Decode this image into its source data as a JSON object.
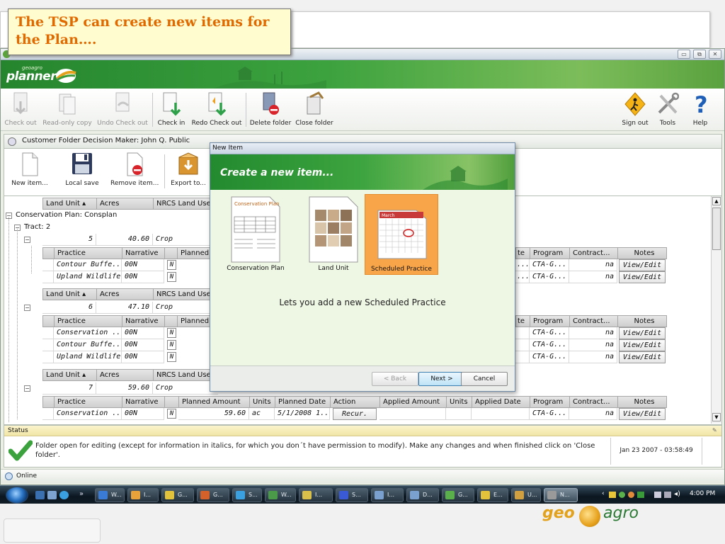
{
  "callout": {
    "text": "The TSP can create new items for the Plan…."
  },
  "window": {
    "title_controls": {
      "minimize": "▭",
      "restore": "⧉",
      "close": "✕"
    },
    "brand": {
      "small": "geoagro",
      "logo": "planner"
    }
  },
  "main_toolbar": {
    "left": [
      {
        "label": "Check out",
        "icon": "check-out-icon",
        "enabled": false
      },
      {
        "label": "Read-only copy",
        "icon": "read-only-copy-icon",
        "enabled": false
      },
      {
        "label": "Undo Check out",
        "icon": "undo-check-out-icon",
        "enabled": false
      },
      {
        "label": "Check in",
        "icon": "check-in-icon",
        "enabled": true
      },
      {
        "label": "Redo Check out",
        "icon": "redo-check-out-icon",
        "enabled": true
      },
      {
        "label": "Delete folder",
        "icon": "delete-folder-icon",
        "enabled": true
      },
      {
        "label": "Close folder",
        "icon": "close-folder-icon",
        "enabled": true
      }
    ],
    "right": [
      {
        "label": "Sign out",
        "icon": "sign-out-icon"
      },
      {
        "label": "Tools",
        "icon": "tools-icon"
      },
      {
        "label": "Help",
        "icon": "help-icon"
      }
    ]
  },
  "folder": {
    "header": "Customer Folder Decision Maker: John Q. Public",
    "toolbar": [
      {
        "label": "New item...",
        "icon": "new-item-icon"
      },
      {
        "label": "Local save",
        "icon": "floppy-disk-icon"
      },
      {
        "label": "Remove item...",
        "icon": "remove-item-icon"
      },
      {
        "label": "Export to...",
        "icon": "export-icon"
      }
    ]
  },
  "grid": {
    "land_headers": [
      "Land Unit",
      "Acres",
      "NRCS Land Use"
    ],
    "plan_label": "Conservation Plan:  Consplan",
    "tract_label": "Tract: 2",
    "practice_headers": [
      "Practice",
      "Narrative",
      "Planned Amount",
      "Units",
      "Planned Date",
      "Action",
      "Applied Amount",
      "Units",
      "Applied Date",
      "Program",
      "Contract...",
      "Notes"
    ],
    "land_units": [
      {
        "unit": "5",
        "acres": "40.60",
        "use": "Crop",
        "practices": [
          {
            "name": "Contour Buffe...",
            "narrative": "00N",
            "flag": "N",
            "program": "CTA-G...",
            "contract": "na",
            "notes": "View/Edit"
          },
          {
            "name": "Upland Wildlife...",
            "narrative": "00N",
            "flag": "N",
            "program": "CTA-G...",
            "contract": "na",
            "notes": "View/Edit"
          }
        ]
      },
      {
        "unit": "6",
        "acres": "47.10",
        "use": "Crop",
        "practices": [
          {
            "name": "Conservation ...",
            "narrative": "00N",
            "flag": "N",
            "program": "CTA-G...",
            "contract": "na",
            "notes": "View/Edit"
          },
          {
            "name": "Contour Buffe...",
            "narrative": "00N",
            "flag": "N",
            "program": "CTA-G...",
            "contract": "na",
            "notes": "View/Edit"
          },
          {
            "name": "Upland Wildlife...",
            "narrative": "00N",
            "flag": "N",
            "program": "CTA-G...",
            "contract": "na",
            "notes": "View/Edit"
          }
        ]
      },
      {
        "unit": "7",
        "acres": "59.60",
        "use": "Crop",
        "practices": [
          {
            "name": "Conservation ...",
            "narrative": "00N",
            "flag": "N",
            "planned_amount": "59.60",
            "units": "ac",
            "planned_date": "5/1/2008 1...",
            "action": "Recur.",
            "program": "CTA-G...",
            "contract": "na",
            "notes": "View/Edit"
          }
        ]
      }
    ],
    "truncated": "..."
  },
  "status": {
    "title": "Status",
    "message": "Folder open for editing (except for information in italics, for which you don´t have permission to modify). Make any changes and when finished click on 'Close folder'.",
    "timestamp": "Jan 23 2007 - 03:58:49"
  },
  "online": "Online",
  "dialog": {
    "title": "New Item",
    "banner": "Create a new item...",
    "items": [
      {
        "label": "Conservation Plan",
        "icon_text": "Conservation Plan",
        "selected": false
      },
      {
        "label": "Land Unit",
        "selected": false
      },
      {
        "label": "Scheduled Practice",
        "icon_text": "March",
        "selected": true
      }
    ],
    "description": "Lets you add a new Scheduled Practice",
    "buttons": {
      "back": "< Back",
      "next": "Next >",
      "cancel": "Cancel"
    }
  },
  "taskbar": {
    "items": [
      {
        "label": "W...",
        "color": "#3a7bd5"
      },
      {
        "label": "I...",
        "color": "#e8a23a"
      },
      {
        "label": "G...",
        "color": "#e2c23a"
      },
      {
        "label": "G...",
        "color": "#d5612a"
      },
      {
        "label": "S...",
        "color": "#3aa0e0"
      },
      {
        "label": "W...",
        "color": "#4a9a4a"
      },
      {
        "label": "I...",
        "color": "#d8c04a"
      },
      {
        "label": "S...",
        "color": "#3a5ad5"
      },
      {
        "label": "I...",
        "color": "#7aa0d0"
      },
      {
        "label": "D...",
        "color": "#7aa0d0"
      },
      {
        "label": "G...",
        "color": "#5ab04a"
      },
      {
        "label": "E...",
        "color": "#e2c23a"
      },
      {
        "label": "U...",
        "color": "#d0a040"
      },
      {
        "label": "N...",
        "color": "#9a9a9a"
      }
    ],
    "clock": "4:00 PM"
  },
  "footer_logo": {
    "left": "geo",
    "right": "agro"
  }
}
